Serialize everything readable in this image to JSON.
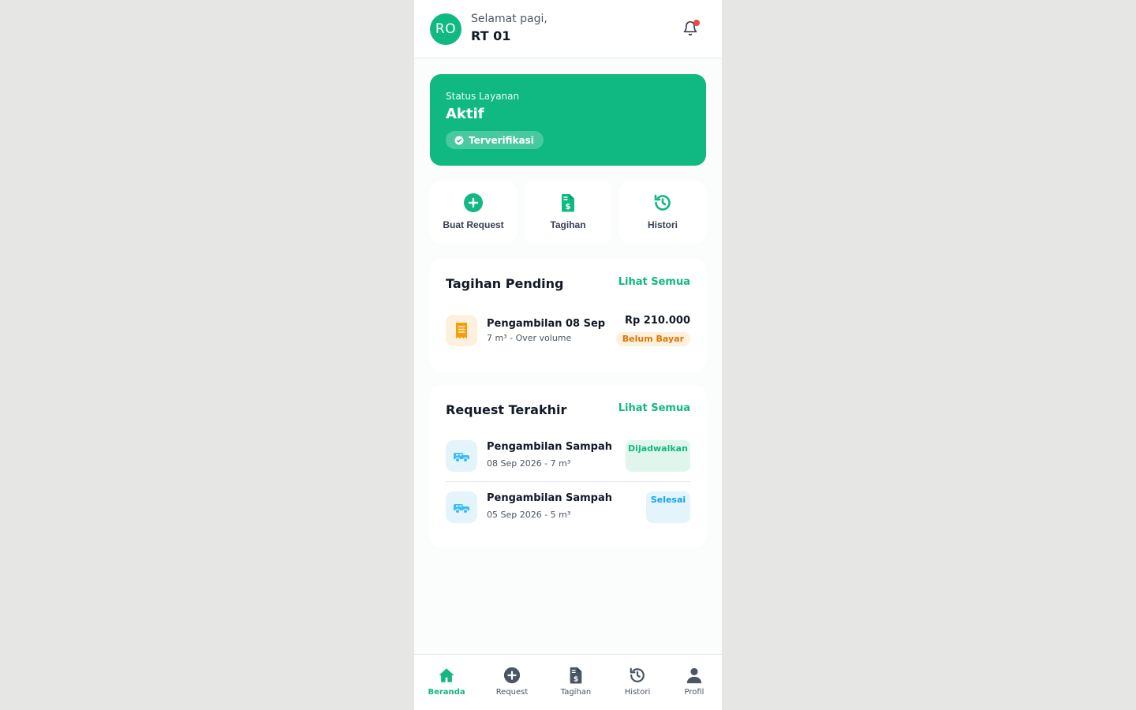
{
  "colors": {
    "primary": "#10b981",
    "danger": "#ef4444",
    "warning": "#d97706",
    "info": "#0ea5e9"
  },
  "header": {
    "avatar_initials": "RO",
    "greeting": "Selamat pagi,",
    "name": "RT 01",
    "notification_icon": "bell-icon"
  },
  "status_card": {
    "label": "Status Layanan",
    "value": "Aktif",
    "badge": "Terverifikasi"
  },
  "quick_actions": [
    {
      "label": "Buat Request",
      "icon": "plus-circle-icon"
    },
    {
      "label": "Tagihan",
      "icon": "invoice-icon"
    },
    {
      "label": "Histori",
      "icon": "history-icon"
    }
  ],
  "pending_bills": {
    "title": "Tagihan Pending",
    "see_all": "Lihat Semua",
    "items": [
      {
        "title": "Pengambilan 08 Sep",
        "subtitle": "7 m³ - Over volume",
        "amount": "Rp 210.000",
        "status": "Belum Bayar",
        "icon": "receipt-icon"
      }
    ]
  },
  "recent_requests": {
    "title": "Request Terakhir",
    "see_all": "Lihat Semua",
    "items": [
      {
        "title": "Pengambilan Sampah",
        "subtitle": "08 Sep 2026 - 7 m³",
        "status": "Dijadwalkan",
        "icon": "truck-icon"
      },
      {
        "title": "Pengambilan Sampah",
        "subtitle": "05 Sep 2026 - 5 m³",
        "status": "Selesai",
        "icon": "truck-icon"
      }
    ]
  },
  "bottom_nav": [
    {
      "label": "Beranda",
      "icon": "home-icon",
      "active": true
    },
    {
      "label": "Request",
      "icon": "plus-circle-icon",
      "active": false
    },
    {
      "label": "Tagihan",
      "icon": "invoice-icon",
      "active": false
    },
    {
      "label": "Histori",
      "icon": "history-icon",
      "active": false
    },
    {
      "label": "Profil",
      "icon": "user-icon",
      "active": false
    }
  ]
}
